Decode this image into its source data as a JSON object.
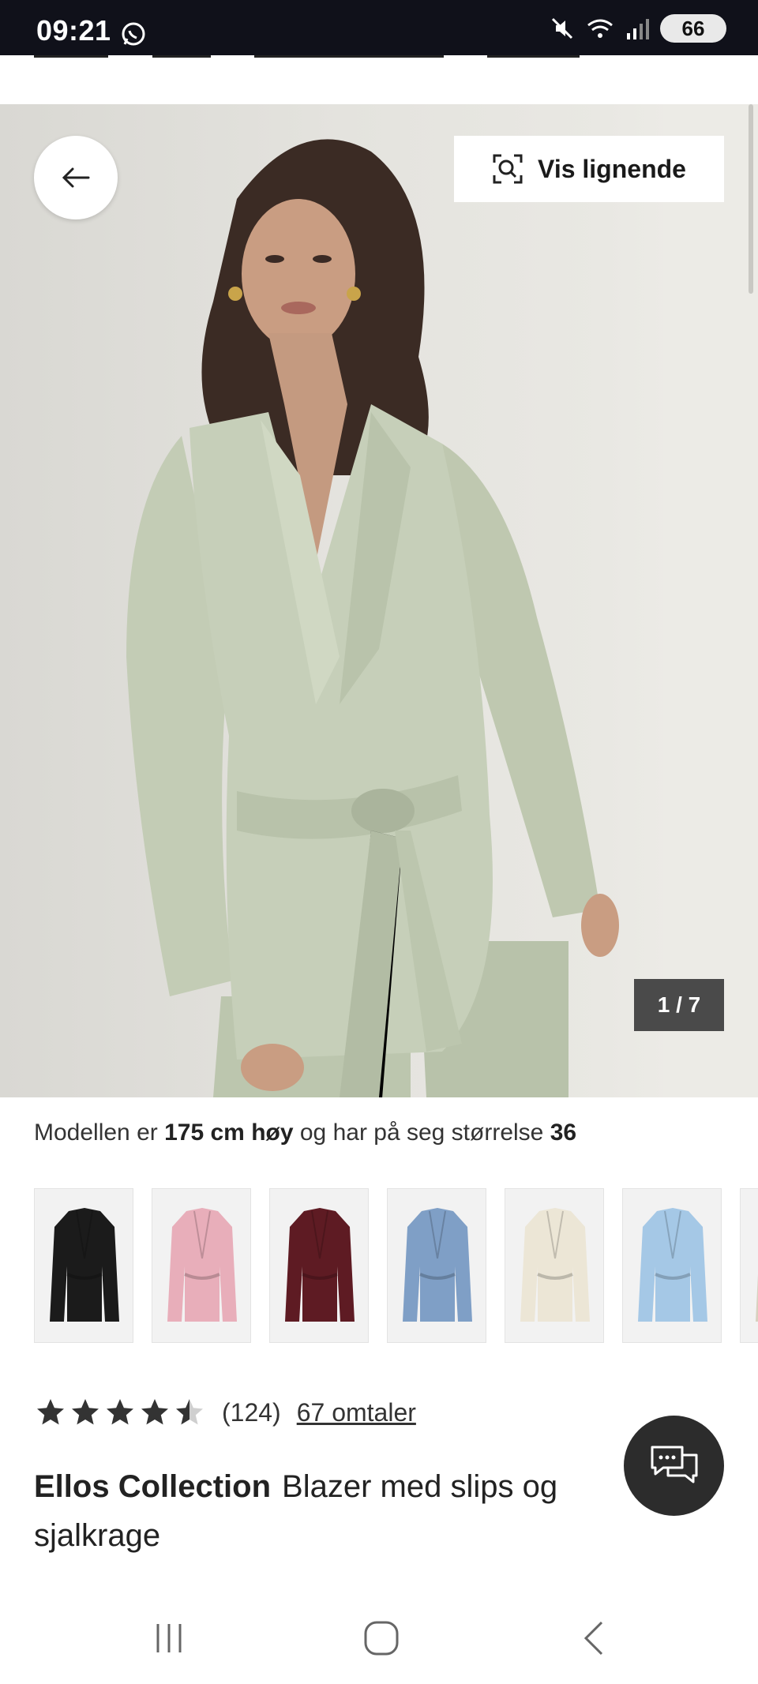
{
  "status_bar": {
    "time": "09:21",
    "battery": "66",
    "icons": [
      "whatsapp-icon",
      "mute-icon",
      "wifi-icon",
      "signal-icon",
      "battery-icon"
    ]
  },
  "product_image": {
    "similar_label": "Vis lignende",
    "counter": "1 / 7",
    "back_icon": "arrow-left-icon",
    "similar_icon": "visual-search-icon"
  },
  "model_info": {
    "prefix": "Modellen er",
    "height": "175 cm høy",
    "middle": "og har på seg størrelse",
    "size": "36"
  },
  "color_variants": [
    {
      "name": "black",
      "color": "#1b1b1b"
    },
    {
      "name": "pink",
      "color": "#e8aeba"
    },
    {
      "name": "burgundy",
      "color": "#5e1b23"
    },
    {
      "name": "blue",
      "color": "#7f9fc6"
    },
    {
      "name": "cream",
      "color": "#ece6d6"
    },
    {
      "name": "light-blue",
      "color": "#a5c8e6"
    },
    {
      "name": "beige",
      "color": "#d8d1bf"
    }
  ],
  "rating": {
    "stars": 4.5,
    "count": "(124)",
    "reviews_link": "67 omtaler"
  },
  "product": {
    "brand": "Ellos Collection",
    "name": "Blazer med slips og sjalkrage"
  },
  "chat": {
    "icon": "chat-icon"
  },
  "nav": {
    "icons": [
      "recent-apps-icon",
      "home-icon",
      "back-icon"
    ]
  },
  "colors": {
    "jacket": "#c6cfb9",
    "accent": "#2c2c2c",
    "status_bar": "#10111a"
  }
}
